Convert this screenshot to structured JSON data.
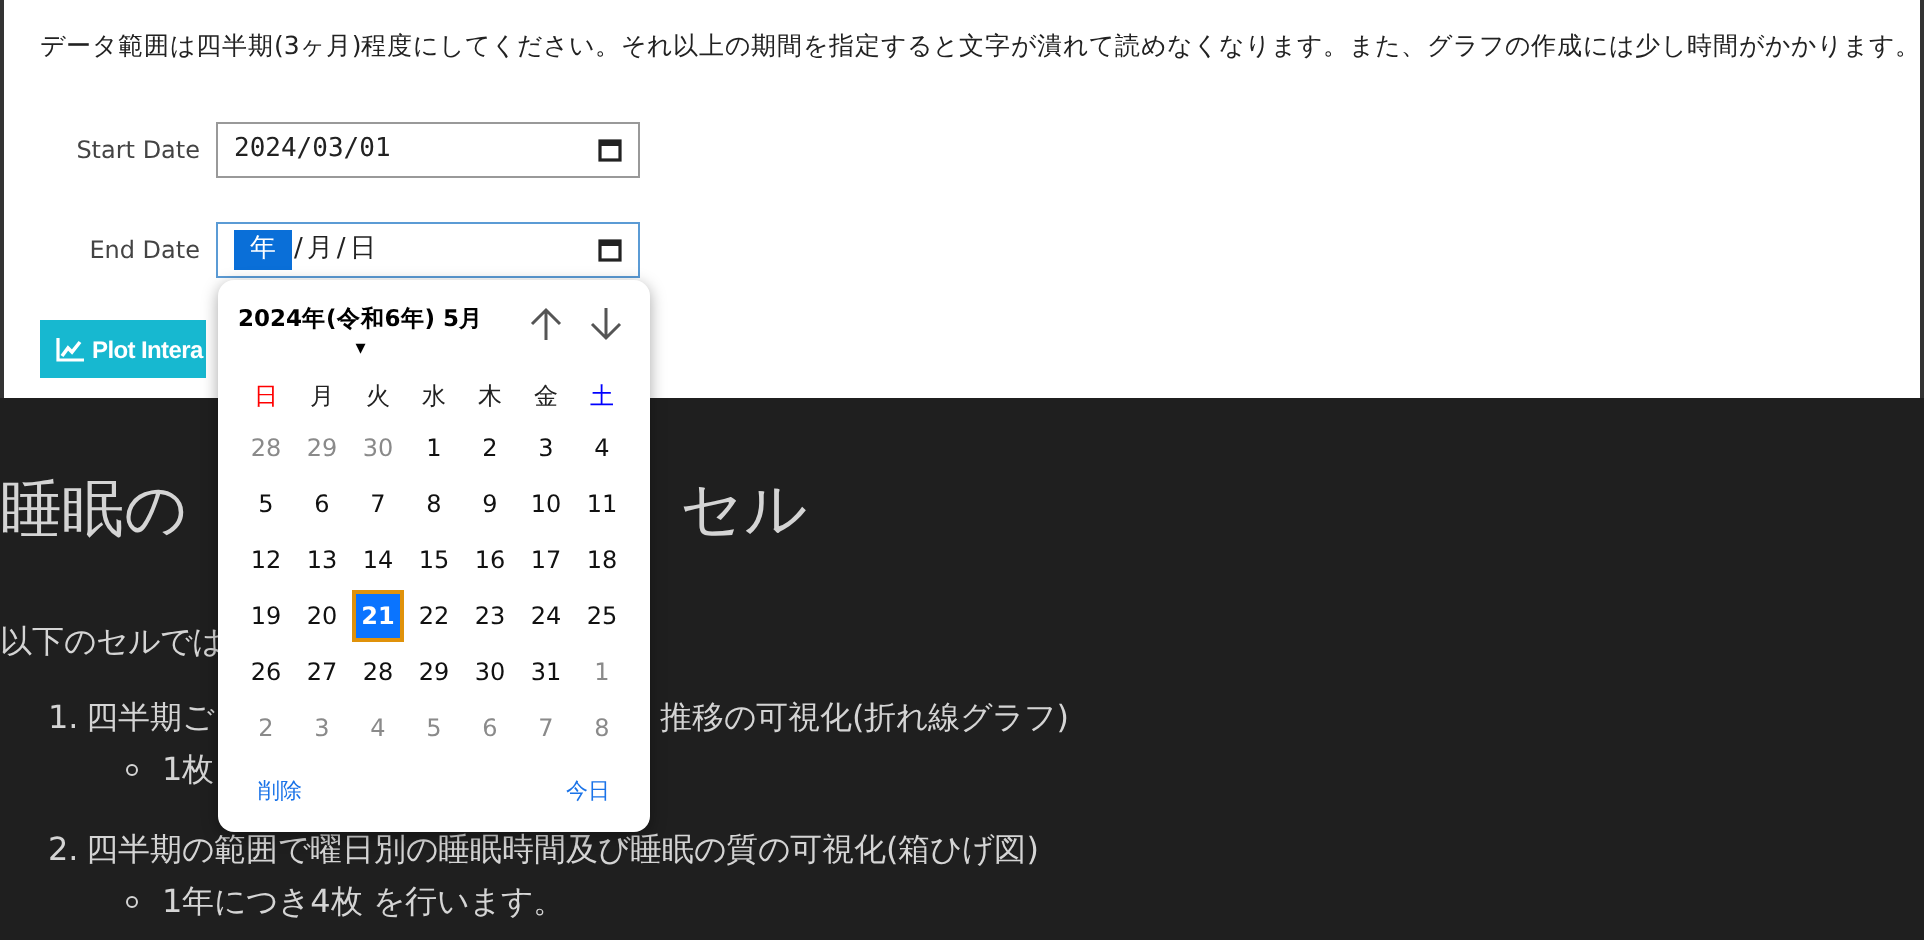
{
  "notice": "データ範囲は四半期(3ヶ月)程度にしてください。それ以上の期間を指定すると文字が潰れて読めなくなります。また、グラフの作成には少し時間がかかります。",
  "start_date": {
    "label": "Start Date",
    "value": "2024/03/01"
  },
  "end_date": {
    "label": "End Date",
    "focused": true,
    "segments": [
      {
        "text": "年",
        "selected": true
      },
      {
        "text": "/",
        "selected": false
      },
      {
        "text": "月",
        "selected": false
      },
      {
        "text": "/",
        "selected": false
      },
      {
        "text": "日",
        "selected": false
      }
    ]
  },
  "plot_button": {
    "label": "Plot Intera"
  },
  "heading": {
    "left": "睡眠の",
    "right": "セル"
  },
  "intro": "以下のセルでは",
  "list": [
    {
      "number": "1.",
      "left": "四半期ご",
      "right": "推移の可視化(折れ線グラフ)",
      "sub": "1枚"
    },
    {
      "number": "2.",
      "left": "四半期の範囲で曜日別の睡眠時間及び睡眠の質の可視化(箱ひげ図)",
      "sub": "1年につき4枚 を行います。"
    }
  ],
  "calendar": {
    "month_label": "2024年(令和6年) 5月",
    "caret": "▾",
    "weekdays": [
      {
        "label": "日",
        "color": "#ff0000"
      },
      {
        "label": "月",
        "color": "#222222"
      },
      {
        "label": "火",
        "color": "#222222"
      },
      {
        "label": "水",
        "color": "#222222"
      },
      {
        "label": "木",
        "color": "#222222"
      },
      {
        "label": "金",
        "color": "#222222"
      },
      {
        "label": "土",
        "color": "#0000ff"
      }
    ],
    "days": [
      {
        "label": "28",
        "other_month": true,
        "selected": false
      },
      {
        "label": "29",
        "other_month": true,
        "selected": false
      },
      {
        "label": "30",
        "other_month": true,
        "selected": false
      },
      {
        "label": "1",
        "other_month": false,
        "selected": false
      },
      {
        "label": "2",
        "other_month": false,
        "selected": false
      },
      {
        "label": "3",
        "other_month": false,
        "selected": false
      },
      {
        "label": "4",
        "other_month": false,
        "selected": false
      },
      {
        "label": "5",
        "other_month": false,
        "selected": false
      },
      {
        "label": "6",
        "other_month": false,
        "selected": false
      },
      {
        "label": "7",
        "other_month": false,
        "selected": false
      },
      {
        "label": "8",
        "other_month": false,
        "selected": false
      },
      {
        "label": "9",
        "other_month": false,
        "selected": false
      },
      {
        "label": "10",
        "other_month": false,
        "selected": false
      },
      {
        "label": "11",
        "other_month": false,
        "selected": false
      },
      {
        "label": "12",
        "other_month": false,
        "selected": false
      },
      {
        "label": "13",
        "other_month": false,
        "selected": false
      },
      {
        "label": "14",
        "other_month": false,
        "selected": false
      },
      {
        "label": "15",
        "other_month": false,
        "selected": false
      },
      {
        "label": "16",
        "other_month": false,
        "selected": false
      },
      {
        "label": "17",
        "other_month": false,
        "selected": false
      },
      {
        "label": "18",
        "other_month": false,
        "selected": false
      },
      {
        "label": "19",
        "other_month": false,
        "selected": false
      },
      {
        "label": "20",
        "other_month": false,
        "selected": false
      },
      {
        "label": "21",
        "other_month": false,
        "selected": true
      },
      {
        "label": "22",
        "other_month": false,
        "selected": false
      },
      {
        "label": "23",
        "other_month": false,
        "selected": false
      },
      {
        "label": "24",
        "other_month": false,
        "selected": false
      },
      {
        "label": "25",
        "other_month": false,
        "selected": false
      },
      {
        "label": "26",
        "other_month": false,
        "selected": false
      },
      {
        "label": "27",
        "other_month": false,
        "selected": false
      },
      {
        "label": "28",
        "other_month": false,
        "selected": false
      },
      {
        "label": "29",
        "other_month": false,
        "selected": false
      },
      {
        "label": "30",
        "other_month": false,
        "selected": false
      },
      {
        "label": "31",
        "other_month": false,
        "selected": false
      },
      {
        "label": "1",
        "other_month": true,
        "selected": false
      },
      {
        "label": "2",
        "other_month": true,
        "selected": false
      },
      {
        "label": "3",
        "other_month": true,
        "selected": false
      },
      {
        "label": "4",
        "other_month": true,
        "selected": false
      },
      {
        "label": "5",
        "other_month": true,
        "selected": false
      },
      {
        "label": "6",
        "other_month": true,
        "selected": false
      },
      {
        "label": "7",
        "other_month": true,
        "selected": false
      },
      {
        "label": "8",
        "other_month": true,
        "selected": false
      }
    ],
    "clear": "削除",
    "today": "今日"
  }
}
